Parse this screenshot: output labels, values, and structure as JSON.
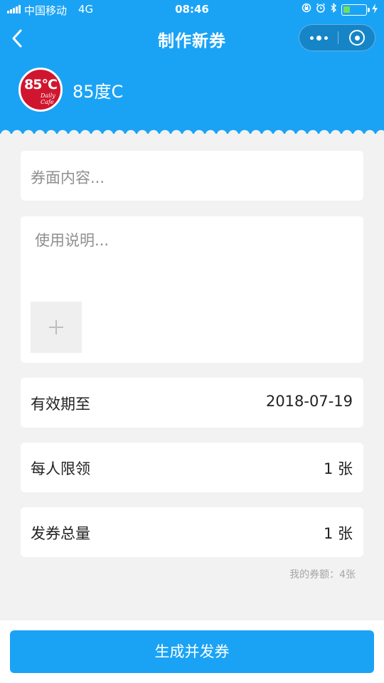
{
  "status_bar": {
    "carrier": "中国移动",
    "network": "4G",
    "time": "08:46",
    "icons": [
      "orientation-lock-icon",
      "alarm-icon",
      "bluetooth-icon",
      "battery-icon",
      "charging-icon"
    ]
  },
  "navbar": {
    "title": "制作新券",
    "back_icon": "chevron-left-icon",
    "more_icon": "more-dots-icon",
    "close_icon": "target-icon"
  },
  "brand": {
    "logo_text": "85°C",
    "logo_subtext_1": "Daily",
    "logo_subtext_2": "Cafe",
    "name": "85度C"
  },
  "form": {
    "coupon_content_placeholder": "券面内容...",
    "usage_placeholder": "使用说明...",
    "add_image_icon": "plus-icon",
    "rows": [
      {
        "label": "有效期至",
        "value": "2018-07-19"
      },
      {
        "label": "每人限领",
        "value": "1 张"
      },
      {
        "label": "发券总量",
        "value": "1 张"
      }
    ],
    "quota_text": "我的券额：4张"
  },
  "footer": {
    "submit_label": "生成并发券"
  },
  "colors": {
    "primary": "#1aa3f5",
    "logo_red": "#d0162f",
    "background": "#f2f2f2"
  }
}
